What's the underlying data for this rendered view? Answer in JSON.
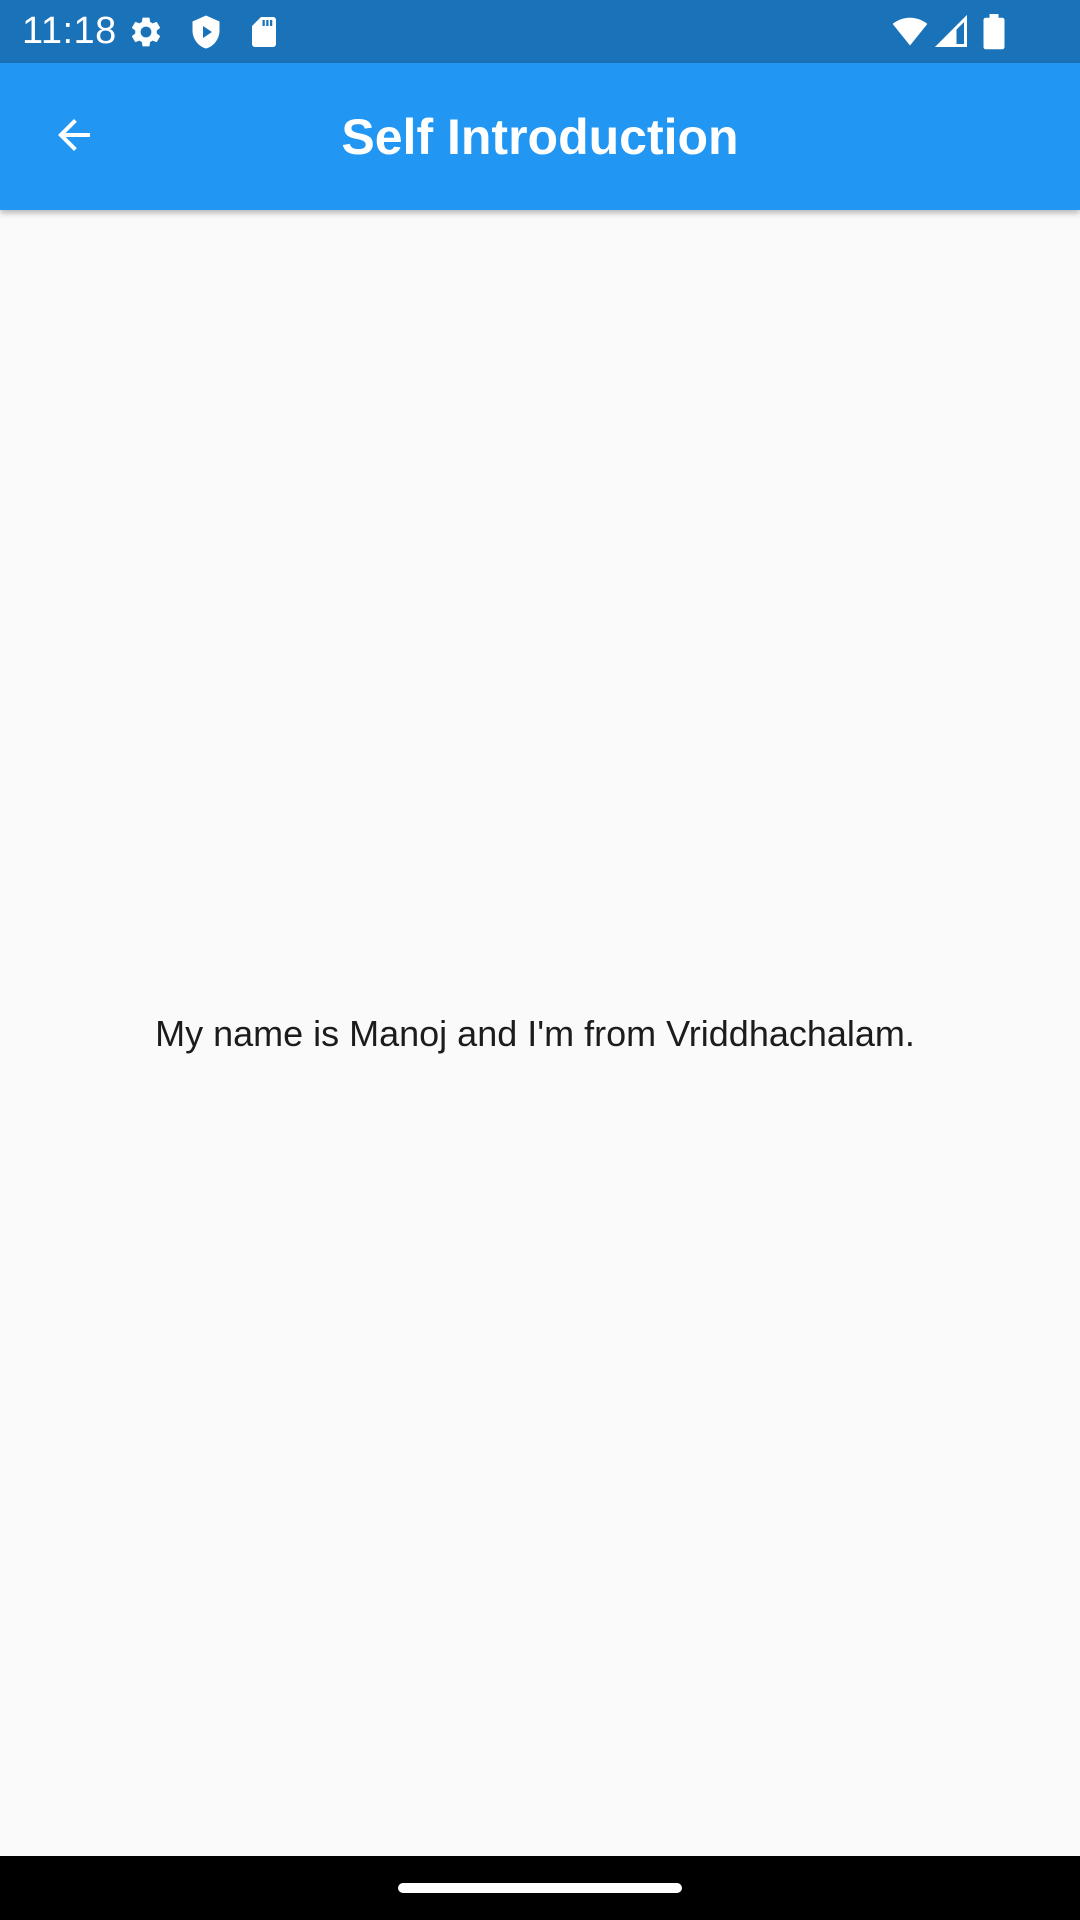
{
  "status_bar": {
    "time": "11:18",
    "icons": [
      "settings-gear-icon",
      "shield-play-icon",
      "sd-card-icon",
      "wifi-icon",
      "cell-signal-icon",
      "battery-icon"
    ]
  },
  "app_bar": {
    "title": "Self Introduction",
    "back_icon": "arrow-back-icon",
    "color": "#2196f3"
  },
  "body": {
    "text": "My name is Manoj and I'm from Vriddhachalam."
  },
  "colors": {
    "status_bar": "#1a72b8",
    "app_bar": "#2196f3",
    "background": "#fafafa"
  }
}
